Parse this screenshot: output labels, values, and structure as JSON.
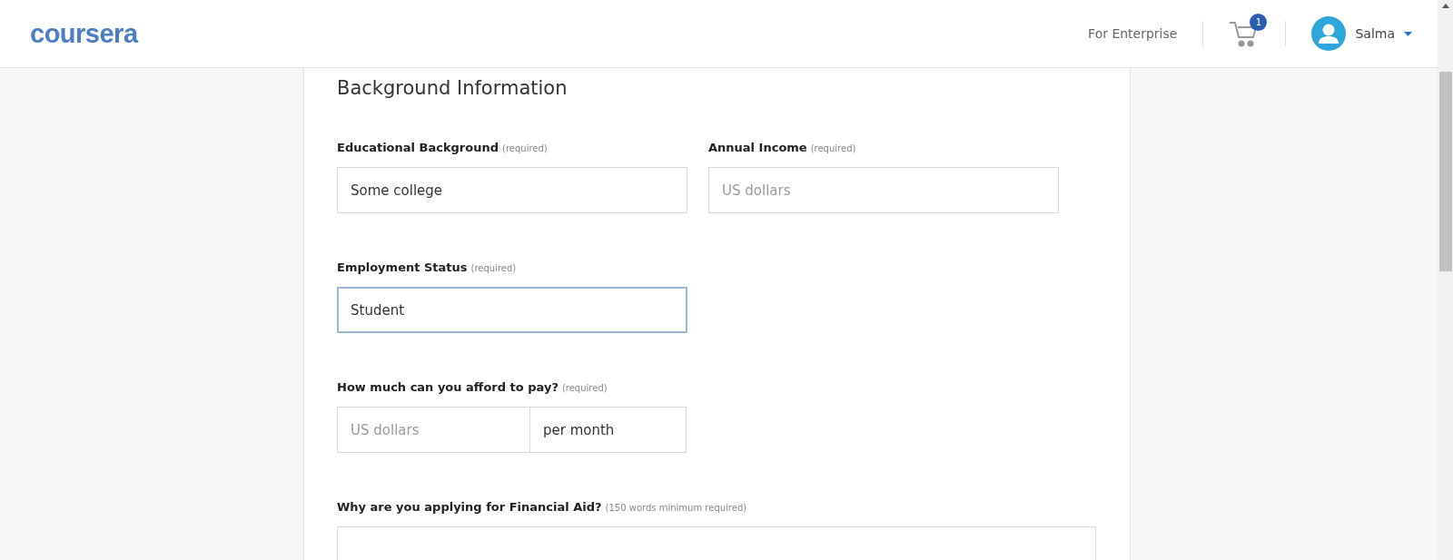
{
  "header": {
    "logo": "coursera",
    "enterprise_link": "For Enterprise",
    "cart_count": "1",
    "user_name": "Salma"
  },
  "form": {
    "title": "Background Information",
    "rows": [
      {
        "fields": [
          {
            "kind": "text",
            "label": "Educational Background",
            "hint": "(required)",
            "value": "Some college",
            "focused": false
          },
          {
            "kind": "text",
            "label": "Annual Income",
            "hint": "(required)",
            "placeholder": "US dollars",
            "focused": false
          }
        ]
      },
      {
        "fields": [
          {
            "kind": "text",
            "label": "Employment Status",
            "hint": "(required)",
            "value": "Student",
            "focused": true
          }
        ]
      },
      {
        "fields": [
          {
            "kind": "amount",
            "label": "How much can you afford to pay?",
            "hint": "(required)",
            "placeholder": "US dollars",
            "unit": "per month",
            "focused": false
          }
        ]
      },
      {
        "fields": [
          {
            "kind": "textarea",
            "label": "Why are you applying for Financial Aid?",
            "hint": "(150 words minimum required)",
            "focused": false
          }
        ]
      }
    ]
  }
}
